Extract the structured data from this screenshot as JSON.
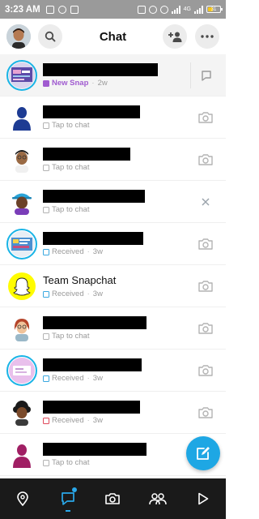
{
  "status_bar": {
    "time": "3:23 AM",
    "battery_level": "31",
    "network": "4G"
  },
  "header": {
    "title": "Chat"
  },
  "chats": [
    {
      "name": "",
      "redact_width": 142,
      "status": "New Snap",
      "time": "2w",
      "status_type": "new",
      "avatar_type": "screenshot-pink",
      "ring": true,
      "action": "reply-icon",
      "action_divider": true,
      "highlight": true
    },
    {
      "name": "",
      "redact_width": 120,
      "status": "Tap to chat",
      "time": "",
      "status_type": "tap",
      "avatar_type": "silhouette-blue",
      "ring": false,
      "action": "camera-icon"
    },
    {
      "name": "",
      "redact_width": 108,
      "status": "Tap to chat",
      "time": "",
      "status_type": "tap",
      "avatar_type": "bitmoji-cap",
      "ring": false,
      "action": "camera-icon"
    },
    {
      "name": "",
      "redact_width": 126,
      "status": "Tap to chat",
      "time": "",
      "status_type": "tap",
      "avatar_type": "bitmoji-hat",
      "ring": false,
      "action": "close-icon"
    },
    {
      "name": "",
      "redact_width": 124,
      "status": "Received",
      "time": "3w",
      "status_type": "received",
      "avatar_type": "screenshot-blue",
      "ring": true,
      "action": "camera-icon"
    },
    {
      "name": "Team Snapchat",
      "redact_width": 0,
      "status": "Received",
      "time": "3w",
      "status_type": "received",
      "avatar_type": "ghost",
      "ring": false,
      "action": "camera-icon"
    },
    {
      "name": "",
      "redact_width": 128,
      "status": "Tap to chat",
      "time": "",
      "status_type": "tap",
      "avatar_type": "bitmoji-redhair",
      "ring": false,
      "action": "camera-icon"
    },
    {
      "name": "",
      "redact_width": 122,
      "status": "Received",
      "time": "3w",
      "status_type": "received",
      "avatar_type": "screenshot-pink",
      "ring": true,
      "action": "camera-icon"
    },
    {
      "name": "",
      "redact_width": 120,
      "status": "Received",
      "time": "3w",
      "status_type": "received-red",
      "avatar_type": "bitmoji-afro",
      "ring": false,
      "action": "camera-icon"
    },
    {
      "name": "",
      "redact_width": 128,
      "status": "Tap to chat",
      "time": "",
      "status_type": "tap",
      "avatar_type": "silhouette-magenta",
      "ring": false,
      "action": "camera-icon"
    }
  ],
  "colors": {
    "accent": "#1ea7e4",
    "new_snap": "#a05bd0",
    "received_chat": "#3aa8e0",
    "received_snap_red": "#e0485a",
    "nav_bg": "#1a1a1a"
  },
  "nav": {
    "items": [
      "map-pin-icon",
      "chat-icon",
      "camera-icon",
      "friends-icon",
      "play-icon"
    ],
    "active": "chat-icon"
  }
}
